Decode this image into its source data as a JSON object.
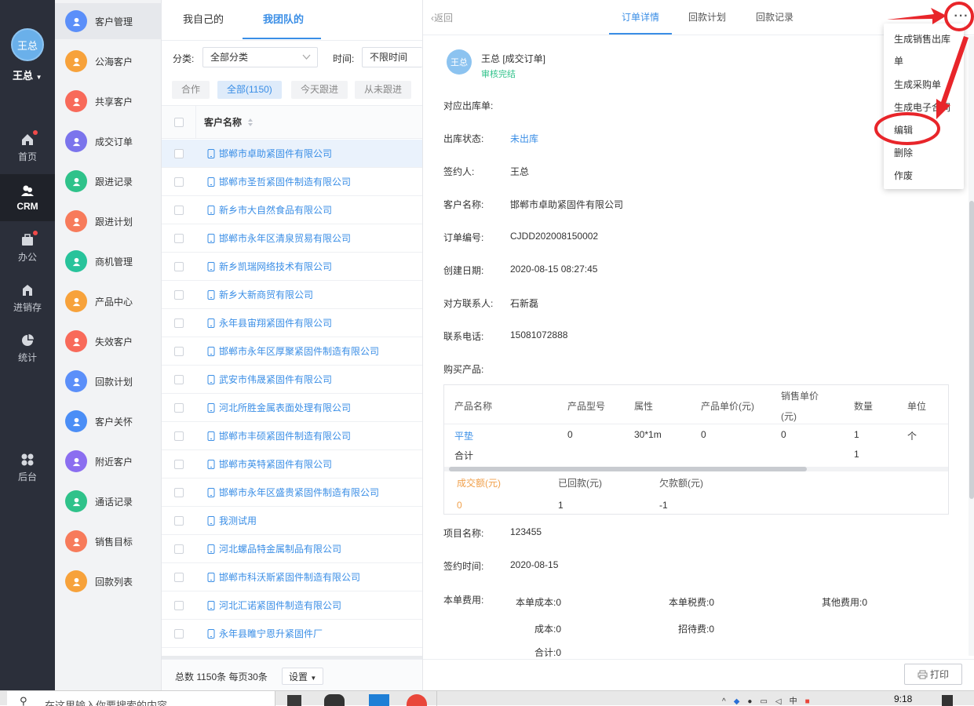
{
  "nav": {
    "user": "王总",
    "user_name": "王总",
    "items": [
      {
        "label": "首页",
        "icon": "home-icon"
      },
      {
        "label": "CRM",
        "icon": "crm-icon"
      },
      {
        "label": "办公",
        "icon": "office-icon"
      },
      {
        "label": "进销存",
        "icon": "inventory-icon"
      },
      {
        "label": "统计",
        "icon": "pie-chart-icon"
      },
      {
        "label": "后台",
        "icon": "admin-icon"
      }
    ]
  },
  "menu": {
    "items": [
      {
        "label": "客户管理",
        "color": "#5b8ff9"
      },
      {
        "label": "公海客户",
        "color": "#f7a23b"
      },
      {
        "label": "共享客户",
        "color": "#f86a5a"
      },
      {
        "label": "成交订单",
        "color": "#7b74ec"
      },
      {
        "label": "跟进记录",
        "color": "#2fc28a"
      },
      {
        "label": "跟进计划",
        "color": "#f77b5b"
      },
      {
        "label": "商机管理",
        "color": "#28c39b"
      },
      {
        "label": "产品中心",
        "color": "#f7a23b"
      },
      {
        "label": "失效客户",
        "color": "#f86a5a"
      },
      {
        "label": "回款计划",
        "color": "#5b8ff9"
      },
      {
        "label": "客户关怀",
        "color": "#4b8ef6"
      },
      {
        "label": "附近客户",
        "color": "#8b6ef0"
      },
      {
        "label": "通话记录",
        "color": "#2fc28a"
      },
      {
        "label": "销售目标",
        "color": "#f77b5b"
      },
      {
        "label": "回款列表",
        "color": "#f7a23b"
      }
    ]
  },
  "list": {
    "tabs": [
      "我自己的",
      "我团队的"
    ],
    "filter_label": "分类:",
    "filter_value": "全部分类",
    "time_label": "时间:",
    "time_value": "不限时间",
    "chips": [
      "合作",
      "全部(1150)",
      "今天跟进",
      "从未跟进"
    ],
    "column_header": "客户名称",
    "rows": [
      "邯郸市卓助紧固件有限公司",
      "邯郸市圣哲紧固件制造有限公司",
      "新乡市大自然食品有限公司",
      "邯郸市永年区清泉贸易有限公司",
      "新乡凯瑞网络技术有限公司",
      "新乡大新商贸有限公司",
      "永年县宙翔紧固件有限公司",
      "邯郸市永年区厚聚紧固件制造有限公司",
      "武安市伟晟紧固件有限公司",
      "河北所胜金属表面处理有限公司",
      "邯郸市丰硕紧固件制造有限公司",
      "邯郸市英特紧固件有限公司",
      "邯郸市永年区盛贵紧固件制造有限公司",
      "我测试用",
      "河北螺品特金属制品有限公司",
      "邯郸市科沃斯紧固件制造有限公司",
      "河北汇诺紧固件制造有限公司",
      "永年县睢宁恩升紧固件厂"
    ],
    "footer": "总数 1150条 每页30条",
    "settings_label": "设置"
  },
  "detail": {
    "back_label": "返回",
    "tabs": [
      "订单详情",
      "回款计划",
      "回款记录"
    ],
    "avatar_text": "王总",
    "title": "王总 [成交订单]",
    "status": "审核完结",
    "fields": [
      {
        "label": "对应出库单:",
        "value": ""
      },
      {
        "label": "出库状态:",
        "value": "未出库",
        "link": true
      },
      {
        "label": "签约人:",
        "value": "王总"
      },
      {
        "label": "客户名称:",
        "value": "邯郸市卓助紧固件有限公司"
      },
      {
        "label": "订单编号:",
        "value": "CJDD202008150002"
      },
      {
        "label": "创建日期:",
        "value": "2020-08-15 08:27:45"
      },
      {
        "label": "对方联系人:",
        "value": "石新磊"
      },
      {
        "label": "联系电话:",
        "value": "15081072888"
      },
      {
        "label": "购买产品:",
        "value": ""
      }
    ],
    "product_table": {
      "headers": [
        "产品名称",
        "产品型号",
        "属性",
        "产品单价(元)",
        "销售单价",
        "(元)",
        "数量",
        "单位"
      ],
      "row": [
        "平垫",
        "0",
        "30*1m",
        "0",
        "0",
        "1",
        "个"
      ],
      "total_label": "合计",
      "total_qty": "1"
    },
    "amounts": {
      "deal_label": "成交额(元)",
      "deal_value": "0",
      "paid_label": "已回款(元)",
      "paid_value": "1",
      "owed_label": "欠款额(元)",
      "owed_value": "-1"
    },
    "project_label": "项目名称:",
    "project_value": "123455",
    "sign_time_label": "签约时间:",
    "sign_time_value": "2020-08-15",
    "cost_label": "本单费用:",
    "costs": {
      "order_cost": "本单成本:0",
      "tax": "本单税费:0",
      "other": "其他费用:0",
      "cost": "成本:0",
      "entertain": "招待费:0",
      "total": "合计:0"
    },
    "print_label": "打印"
  },
  "dropdown": {
    "items": [
      "生成销售出库",
      "单",
      "生成采购单",
      "生成电子合同",
      "编辑",
      "删除",
      "作废"
    ]
  },
  "taskbar": {
    "search_placeholder": "在这里输入你要搜索的内容",
    "time": "9:18"
  }
}
